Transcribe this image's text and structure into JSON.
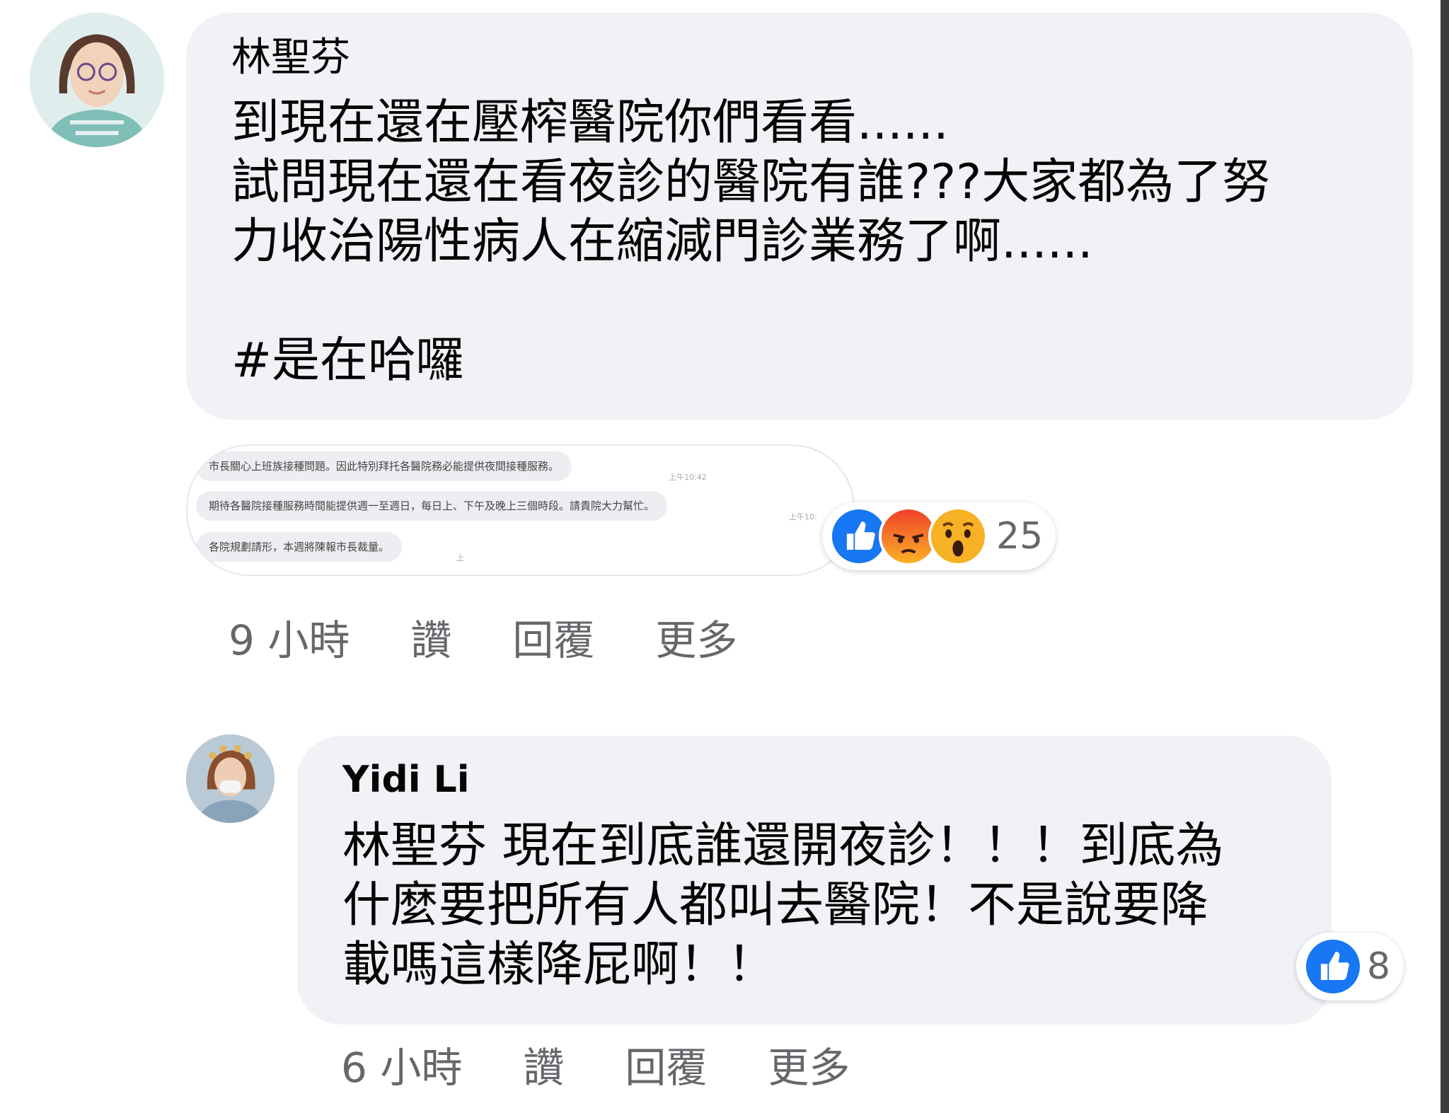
{
  "comments": [
    {
      "author": "林聖芬",
      "lines": [
        "到現在還在壓榨醫院你們看看......",
        "試問現在還在看夜診的醫院有誰???大家都為了努",
        "力收治陽性病人在縮減門診業務了啊......",
        "",
        "#是在哈囉"
      ],
      "attachment": {
        "messages": [
          {
            "text": "市長關心上班族接種問題。因此特別拜托各醫院務必能提供夜間接種服務。",
            "time": "上午10:42"
          },
          {
            "text": "期待各醫院接種服務時間能提供週一至週日，每日上、下午及晚上三個時段。請貴院大力幫忙。",
            "time": "上午10:"
          },
          {
            "text": "各院規劃請形，本週將陳報市長裁量。",
            "time": "上"
          }
        ]
      },
      "reactions": {
        "icons": [
          "like-icon",
          "angry-icon",
          "wow-icon"
        ],
        "count": "25"
      },
      "time": "9 小時",
      "actions": {
        "like": "讚",
        "reply": "回覆",
        "more": "更多"
      }
    },
    {
      "author": "Yidi Li",
      "lines": [
        "林聖芬 現在到底誰還開夜診！！！到底為",
        "什麼要把所有人都叫去醫院！不是說要降",
        "載嗎這樣降屁啊！！"
      ],
      "reactions": {
        "icons": [
          "like-icon"
        ],
        "count": "8"
      },
      "time": "6 小時",
      "actions": {
        "like": "讚",
        "reply": "回覆",
        "more": "更多"
      }
    }
  ],
  "colors": {
    "bubble": "#f0f2f5",
    "meta_text": "#65676b",
    "like_blue": "#1877f2",
    "angry_orange": "#e9710f",
    "wow_yellow": "#f7b125"
  }
}
